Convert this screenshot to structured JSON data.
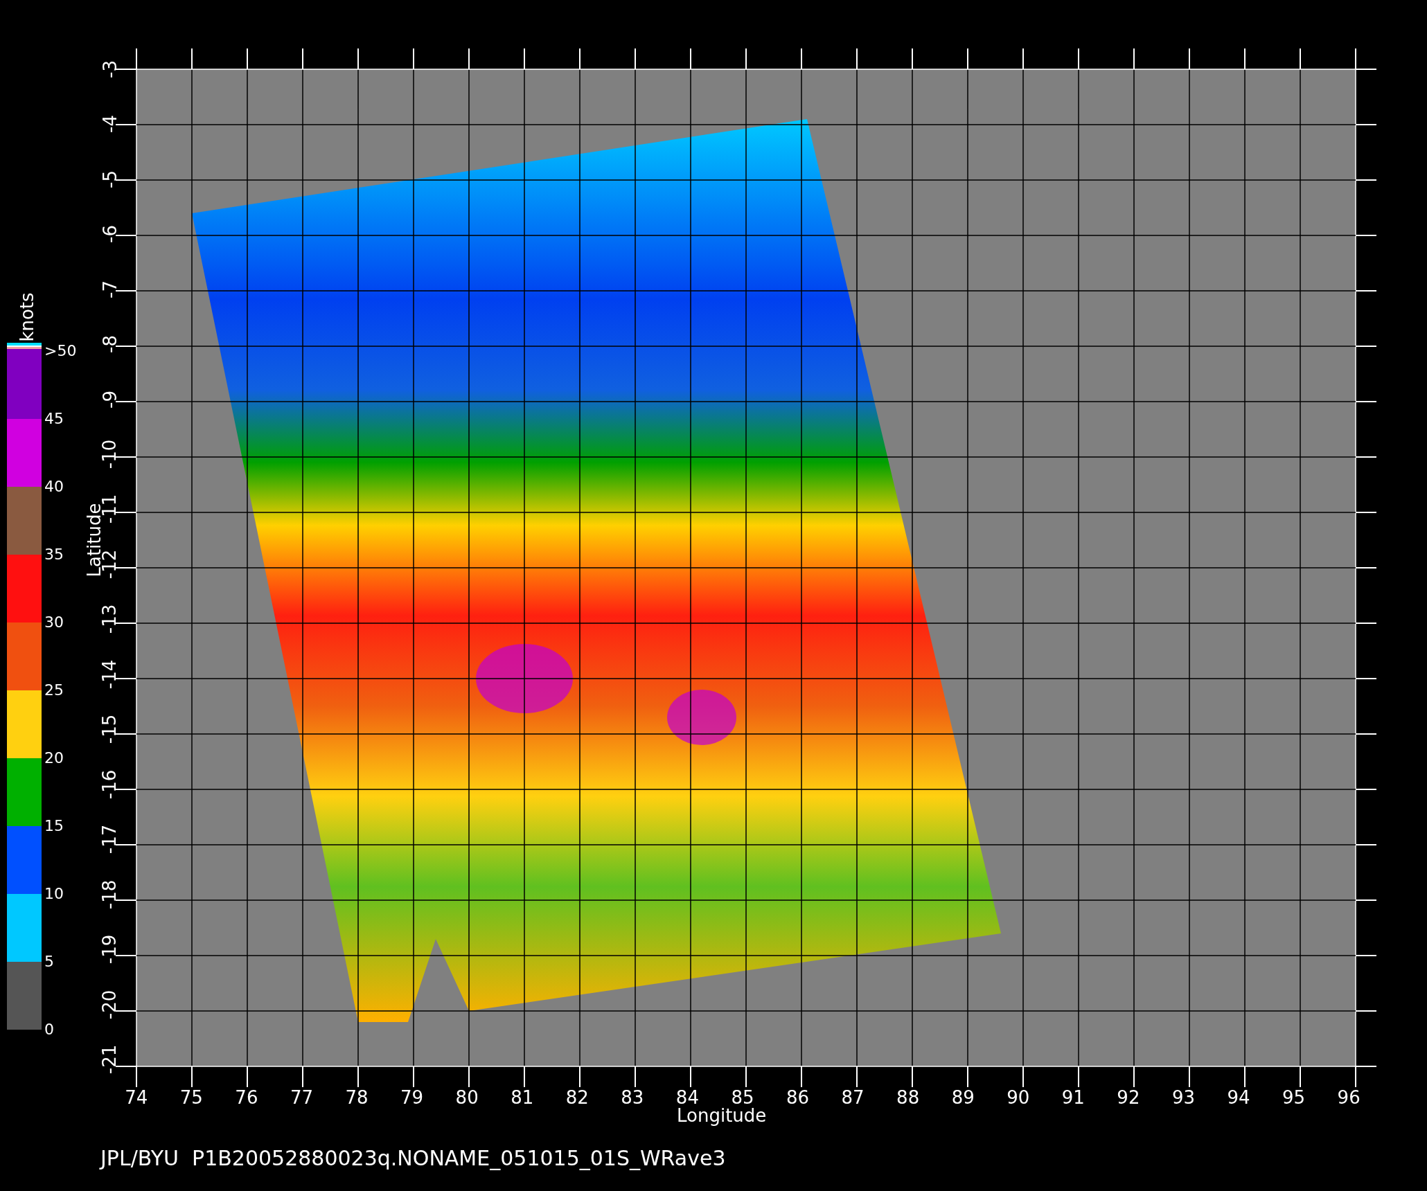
{
  "colorbar": {
    "unit": "knots",
    "labels": [
      ">50",
      "45",
      "40",
      "35",
      "30",
      "25",
      "20",
      "15",
      "10",
      "5",
      "0"
    ],
    "bands": [
      {
        "color": "#8000c0"
      },
      {
        "color": "#d000e0"
      },
      {
        "color": "#8a5a40"
      },
      {
        "color": "#ff1010"
      },
      {
        "color": "#f05010"
      },
      {
        "color": "#ffd010"
      },
      {
        "color": "#00b000"
      },
      {
        "color": "#0050ff"
      },
      {
        "color": "#00c8ff"
      },
      {
        "color": "#555555"
      }
    ]
  },
  "map": {
    "xlabel": "Longitude",
    "ylabel": "Latitude",
    "xticks": [
      "74",
      "75",
      "76",
      "77",
      "78",
      "79",
      "80",
      "81",
      "82",
      "83",
      "84",
      "85",
      "86",
      "87",
      "88",
      "89",
      "90",
      "91",
      "92",
      "93",
      "94",
      "95",
      "96"
    ],
    "yticks": [
      "-3",
      "-4",
      "-5",
      "-6",
      "-7",
      "-8",
      "-9",
      "-10",
      "-11",
      "-12",
      "-13",
      "-14",
      "-15",
      "-16",
      "-17",
      "-18",
      "-19",
      "-20",
      "-21"
    ]
  },
  "caption": "JPL/BYU  P1B20052880023q.NONAME_051015_01S_WRave3"
}
